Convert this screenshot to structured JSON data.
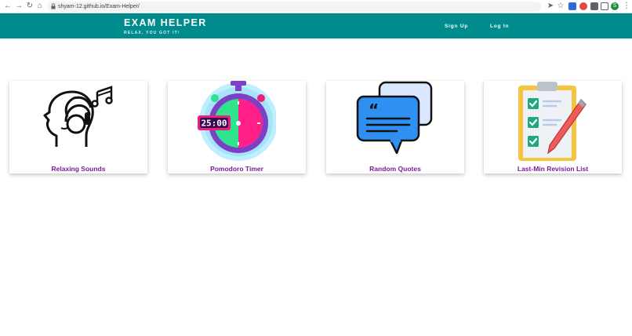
{
  "browser": {
    "url": "shyam-12.github.io/Exam-Helper/",
    "profile_initial": "S"
  },
  "header": {
    "title": "EXAM HELPER",
    "tagline": "RELAX, YOU GOT IT!",
    "nav": [
      {
        "label": "Sign Up"
      },
      {
        "label": "Log In"
      }
    ]
  },
  "cards": [
    {
      "label": "Relaxing Sounds",
      "icon": "headphones-head-icon"
    },
    {
      "label": "Pomodoro Timer",
      "icon": "stopwatch-icon",
      "timer_text": "25:00"
    },
    {
      "label": "Random Quotes",
      "icon": "speech-bubbles-icon"
    },
    {
      "label": "Last-Min Revision List",
      "icon": "clipboard-checklist-icon"
    }
  ],
  "colors": {
    "header_bg": "#008c8c",
    "card_label": "#7a1b99"
  }
}
